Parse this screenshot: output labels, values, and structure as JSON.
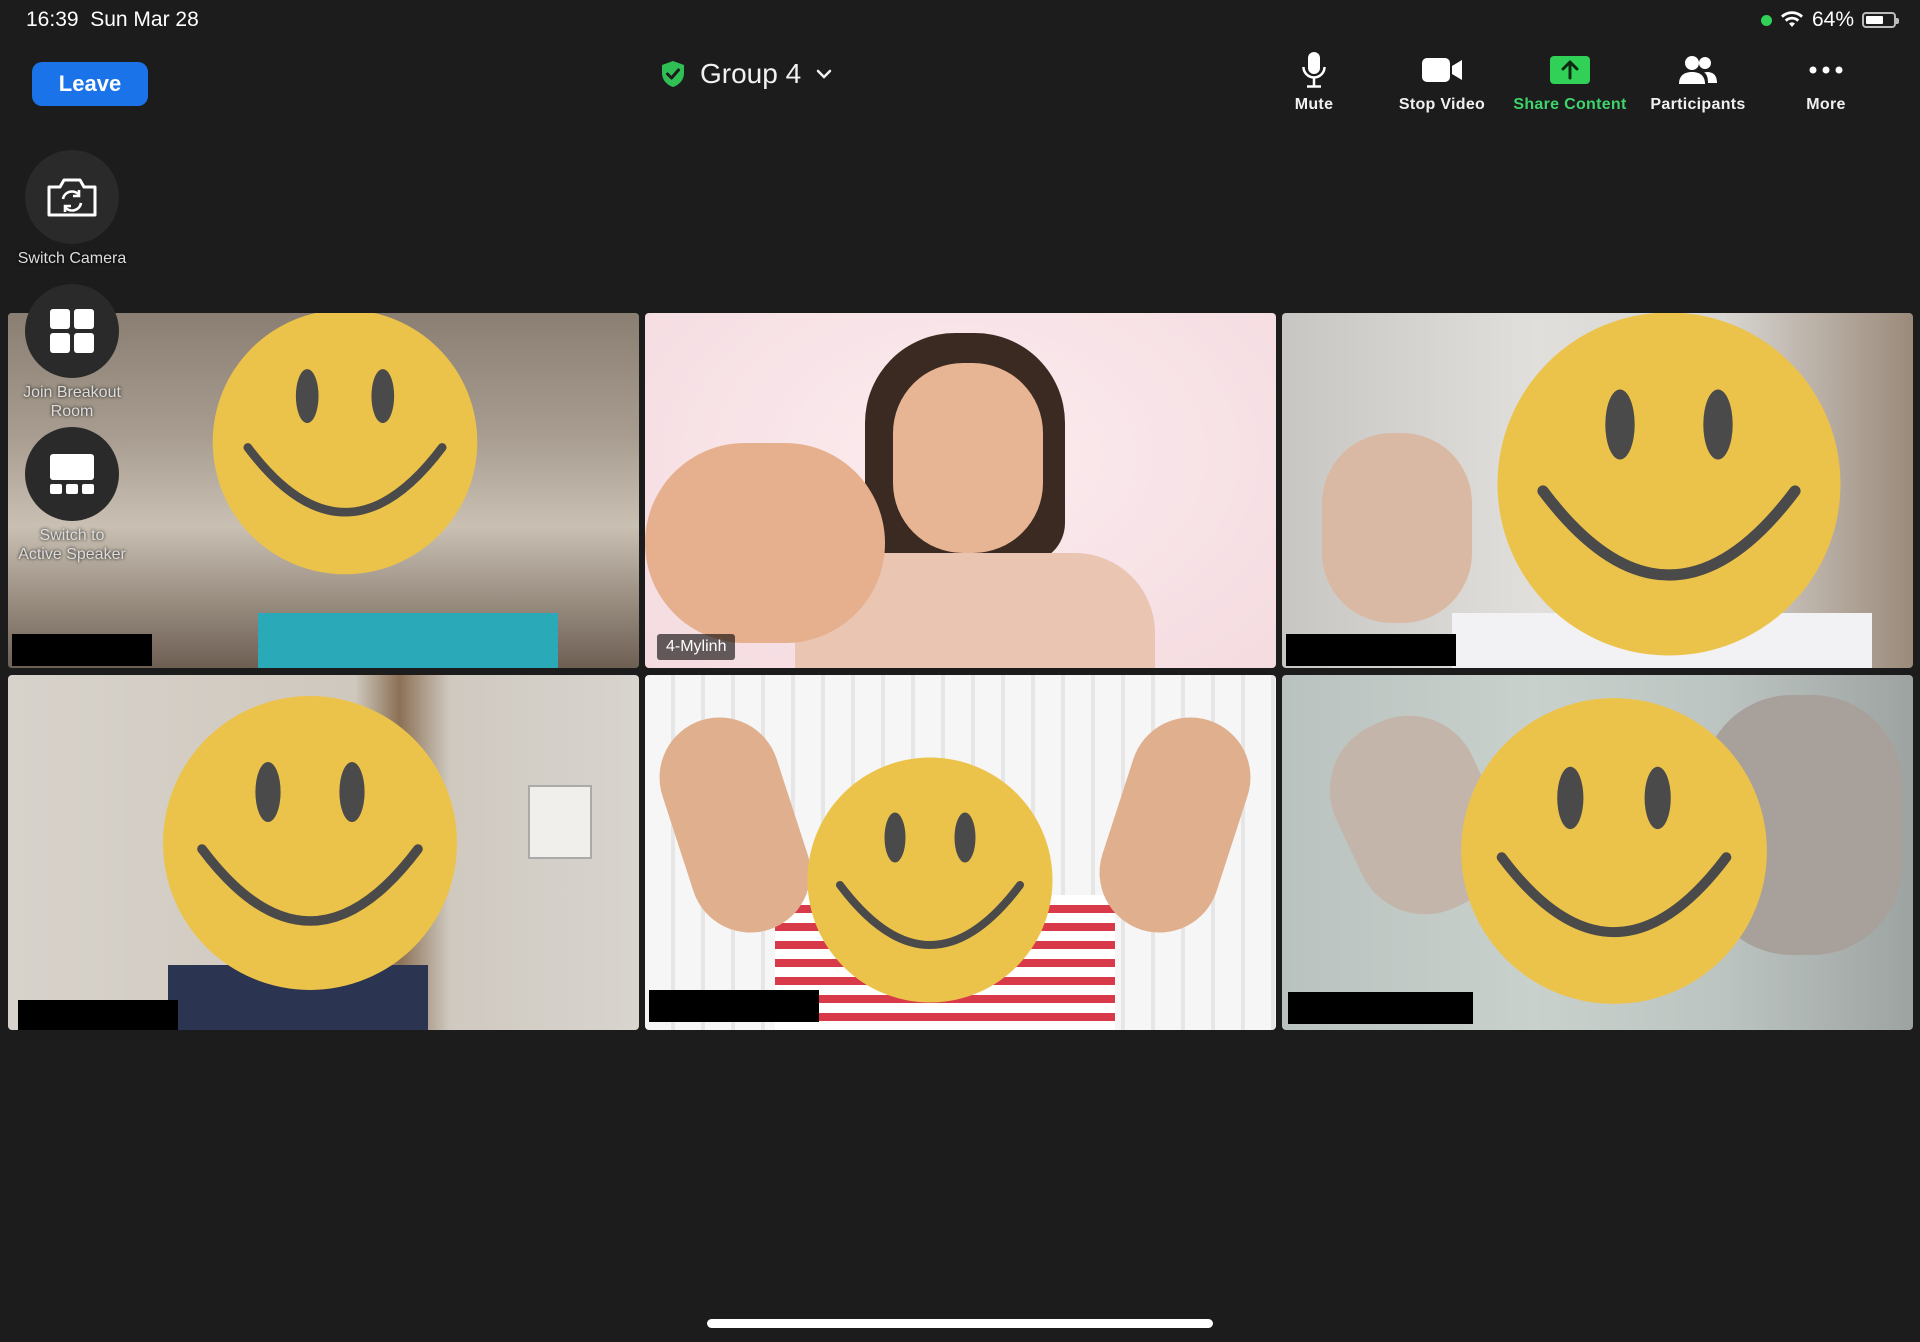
{
  "status_bar": {
    "time": "16:39",
    "date": "Sun Mar 28",
    "battery": "64%",
    "battery_level": 0.64
  },
  "header": {
    "leave_label": "Leave",
    "meeting_title": "Group 4",
    "toolbar": [
      {
        "label": "Mute",
        "icon": "microphone-icon"
      },
      {
        "label": "Stop Video",
        "icon": "video-camera-icon"
      },
      {
        "label": "Share Content",
        "icon": "share-screen-icon"
      },
      {
        "label": "Participants",
        "icon": "participants-icon"
      },
      {
        "label": "More",
        "icon": "more-icon"
      }
    ]
  },
  "side_controls": [
    {
      "label": "Switch Camera",
      "icon": "switch-camera-icon"
    },
    {
      "label": "Join Breakout Room",
      "icon": "breakout-room-icon"
    },
    {
      "label": "Switch to Active Speaker",
      "icon": "active-speaker-icon"
    }
  ],
  "participants": [
    {
      "name": "",
      "active": true
    },
    {
      "name": "4-Mylinh",
      "active": false
    },
    {
      "name": "",
      "active": false
    },
    {
      "name": "",
      "active": false
    },
    {
      "name": "",
      "active": false
    },
    {
      "name": "",
      "active": false
    }
  ],
  "colors": {
    "accent_blue": "#1a73e8",
    "active_speaker": "#2fbf55",
    "share_green": "#31d158",
    "background": "#1c1c1c",
    "smiley": "#ecc34a"
  }
}
